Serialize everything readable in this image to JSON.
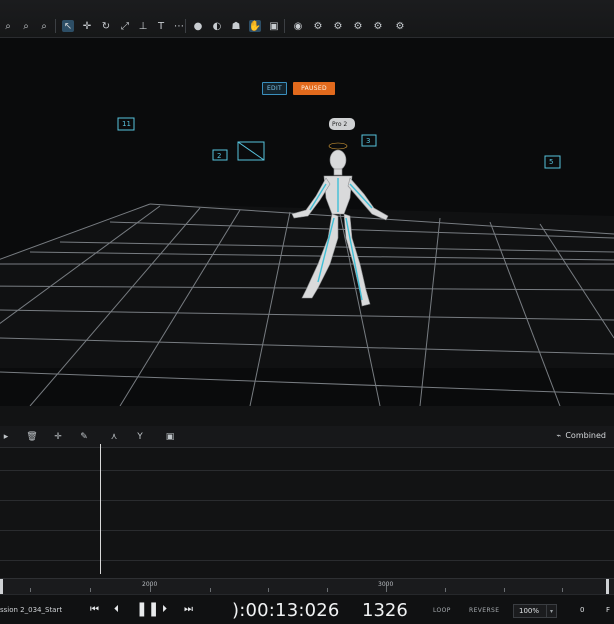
{
  "toolbar": {
    "icons": [
      "zoom-fit-icon",
      "zoom-region-icon",
      "zoom-out-icon",
      "select-icon",
      "move-icon",
      "rotate-icon",
      "scale-icon",
      "text-icon",
      "marker-icon",
      "bone-icon",
      "skeleton-icon",
      "cursor-icon",
      "frame-icon",
      "eye-icon",
      "camera-icon",
      "rig-icon",
      "rig-solve-icon",
      "layer-icon",
      "pose-icon"
    ]
  },
  "viewport": {
    "mode_edit": "EDIT",
    "mode_paused": "PAUSED",
    "marker_labels": [
      "11",
      "2",
      "3",
      "5"
    ],
    "actor_badge": "Pro 2"
  },
  "timeline": {
    "view_mode": "Combined",
    "ruler_labels": [
      "2000",
      "3000"
    ]
  },
  "transport": {
    "session": "ssion 2_034_Start",
    "timecode": "):00:13:026",
    "frame": "1326",
    "loop_label": "LOOP",
    "reverse_label": "REVERSE",
    "zoom": "100%",
    "frame_field": "0",
    "frame_suffix": "F"
  },
  "colors": {
    "accent_blue": "#3a8fbd",
    "paused_orange": "#e26a1d",
    "grid": "#9aa0a6",
    "marker_cyan": "#57c3dd"
  }
}
